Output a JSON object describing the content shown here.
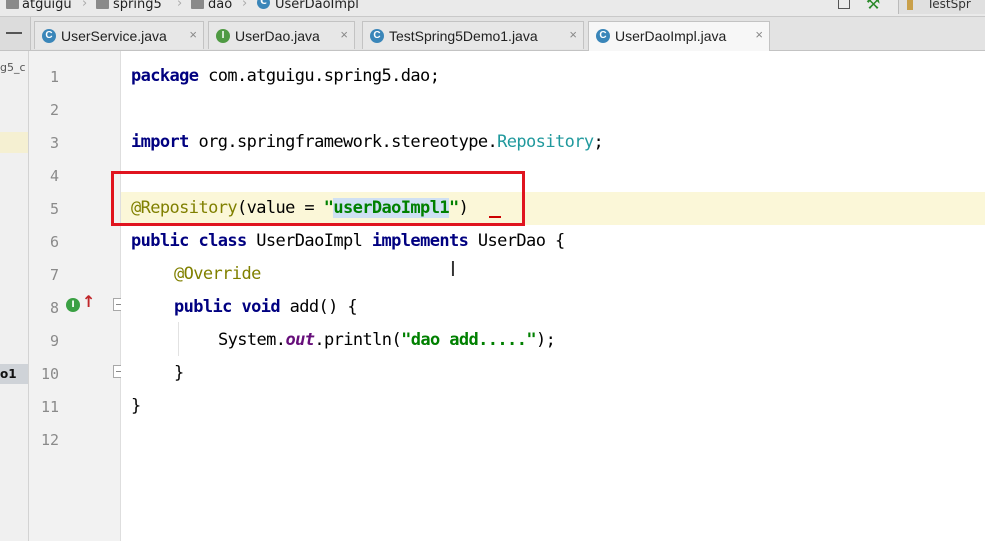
{
  "breadcrumb": {
    "items": [
      "atguigu",
      "spring5",
      "dao",
      "UserDaoImpl"
    ],
    "right_label": "TestSpr"
  },
  "tabs": [
    {
      "label": "UserService.java",
      "icon": "class-icon",
      "icon_letter": "C",
      "active": false
    },
    {
      "label": "UserDao.java",
      "icon": "interface-icon",
      "icon_letter": "I",
      "active": false
    },
    {
      "label": "TestSpring5Demo1.java",
      "icon": "class-icon",
      "icon_letter": "C",
      "active": false
    },
    {
      "label": "UserDaoImpl.java",
      "icon": "class-icon",
      "icon_letter": "C",
      "active": true
    }
  ],
  "close_glyph": "×",
  "left_panel": {
    "text_top": "g5_c",
    "text_bottom": "o1"
  },
  "line_numbers": [
    "1",
    "2",
    "3",
    "4",
    "5",
    "6",
    "7",
    "8",
    "9",
    "10",
    "11",
    "12"
  ],
  "code": {
    "l1_kw": "package",
    "l1_rest": " com.atguigu.spring5.dao;",
    "l3_kw": "import",
    "l3_pkg": " org.springframework.stereotype.",
    "l3_cls": "Repository",
    "l3_end": ";",
    "l5_ann": "@Repository",
    "l5_mid": "(value = ",
    "l5_q1": "\"",
    "l5_sel": "userDaoImpl1",
    "l5_q2": "\"",
    "l5_end": ")",
    "l6_kw1": "public class",
    "l6_name": " UserDaoImpl ",
    "l6_kw2": "implements",
    "l6_rest": " UserDao {",
    "l7_ann": "@Override",
    "l8_kw": "public void",
    "l8_rest": " add() {",
    "l9_a": "System.",
    "l9_field": "out",
    "l9_b": ".println(",
    "l9_str": "\"dao add.....\"",
    "l9_c": ");",
    "l10": "}",
    "l11": "}"
  },
  "colors": {
    "keyword": "#000080",
    "annotation": "#808000",
    "string": "#008000",
    "highlight_box": "#e0141f",
    "current_line": "#fbf7d8"
  }
}
